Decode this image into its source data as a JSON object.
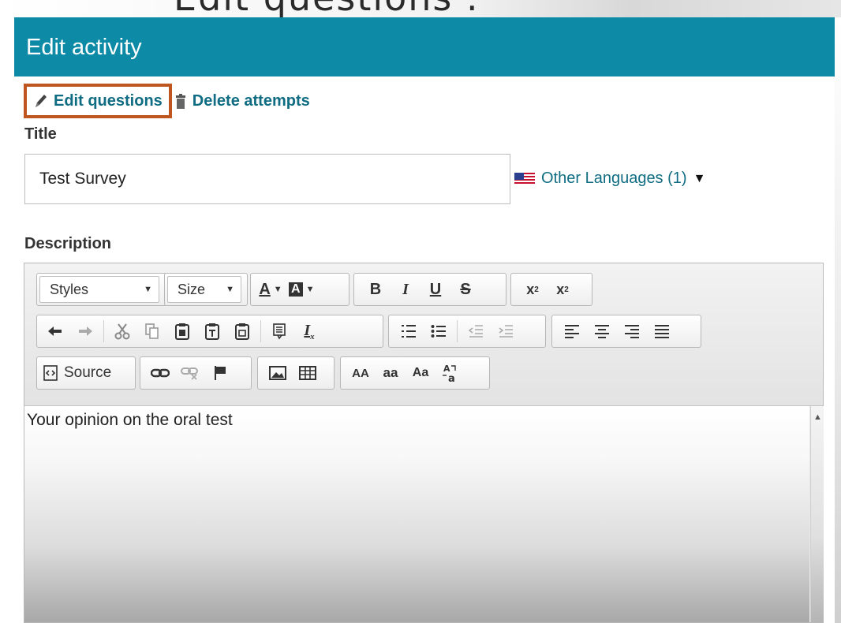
{
  "caption": {
    "text": "Edit questions ."
  },
  "header": {
    "title": "Edit activity"
  },
  "actions": {
    "edit_questions": "Edit questions",
    "delete_attempts": "Delete attempts"
  },
  "form": {
    "title_label": "Title",
    "title_value": "Test Survey",
    "other_languages": "Other Languages (1)",
    "other_languages_caret": "▼",
    "description_label": "Description"
  },
  "toolbar": {
    "styles": "Styles",
    "size": "Size",
    "text_color": "A",
    "bg_color": "A",
    "bold": "B",
    "italic": "I",
    "underline": "U",
    "strike": "S",
    "source": "Source",
    "uppercase": "AA",
    "lowercase": "aa",
    "capitalize": "Aa"
  },
  "editor": {
    "content": "Your opinion on the oral test"
  },
  "colors": {
    "header_bg": "#0d8aa6",
    "link": "#0f6c82",
    "highlight_border": "#c0561f"
  }
}
